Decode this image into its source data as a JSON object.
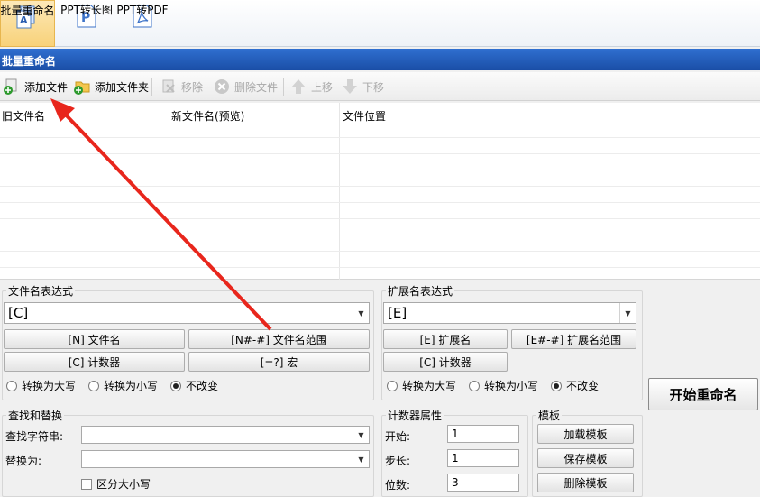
{
  "top_toolbar": {
    "items": [
      {
        "label": "批量重命名",
        "icon": "batch-rename-icon"
      },
      {
        "label": "PPT转长图",
        "icon": "ppt-icon"
      },
      {
        "label": "PPT转PDF",
        "icon": "pdf-icon"
      }
    ]
  },
  "panel": {
    "title": "批量重命名"
  },
  "actions": {
    "add_file": "添加文件",
    "add_folder": "添加文件夹",
    "remove": "移除",
    "delete_file": "删除文件",
    "move_up": "上移",
    "move_down": "下移"
  },
  "file_list": {
    "columns": [
      "旧文件名",
      "新文件名(预览)",
      "文件位置"
    ]
  },
  "filename_expr": {
    "title": "文件名表达式",
    "value": "[C]",
    "buttons": [
      "[N] 文件名",
      "[N#-#] 文件名范围",
      "[C] 计数器",
      "[=?] 宏"
    ],
    "radios": [
      "转换为大写",
      "转换为小写",
      "不改变"
    ],
    "selected": "不改变"
  },
  "ext_expr": {
    "title": "扩展名表达式",
    "value": "[E]",
    "buttons": [
      "[E] 扩展名",
      "[E#-#] 扩展名范围",
      "[C] 计数器"
    ],
    "radios": [
      "转换为大写",
      "转换为小写",
      "不改变"
    ],
    "selected": "不改变"
  },
  "find_replace": {
    "title": "查找和替换",
    "find_label": "查找字符串:",
    "replace_label": "替换为:",
    "case_label": "区分大小写"
  },
  "counter": {
    "title": "计数器属性",
    "start_label": "开始:",
    "start_value": "1",
    "step_label": "步长:",
    "step_value": "1",
    "digits_label": "位数:",
    "digits_value": "3"
  },
  "template": {
    "title": "模板",
    "load": "加载模板",
    "save": "保存模板",
    "delete": "删除模板"
  },
  "start_button": "开始重命名",
  "colors": {
    "title_bar": "#1a4ea6",
    "annotation_arrow": "#e8261c"
  }
}
